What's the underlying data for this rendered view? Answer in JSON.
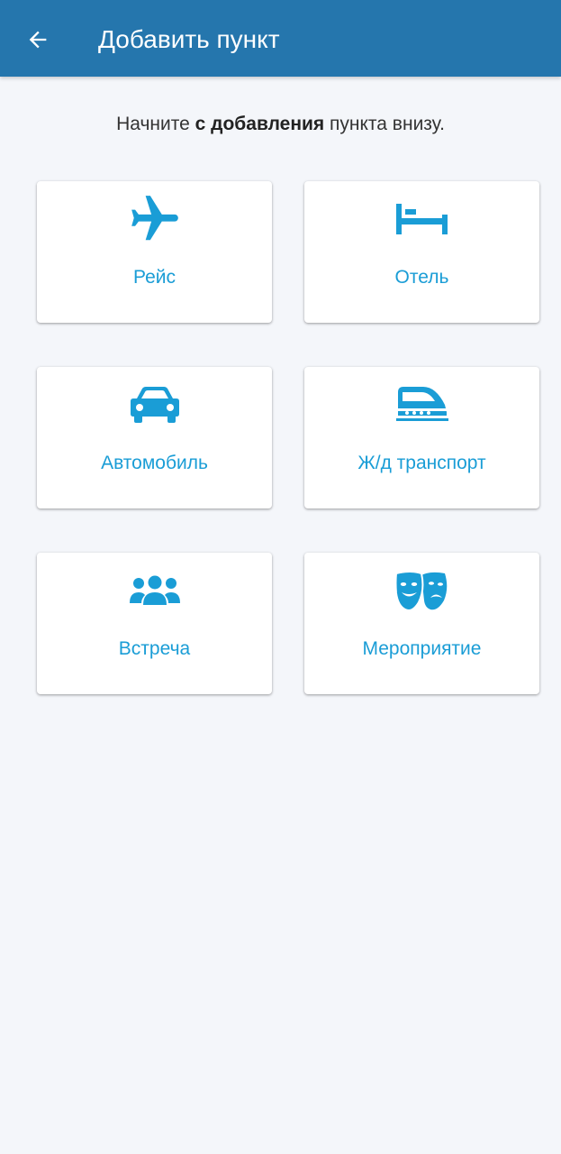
{
  "header": {
    "back_icon": "arrow-left-icon",
    "title": "Добавить пункт"
  },
  "intro": {
    "text_before": "Начните ",
    "text_bold": "с добавления",
    "text_after": " пункта внизу."
  },
  "options": [
    {
      "label": "Рейс",
      "icon": "airplane-icon"
    },
    {
      "label": "Отель",
      "icon": "bed-icon"
    },
    {
      "label": "Автомобиль",
      "icon": "car-icon"
    },
    {
      "label": "Ж/д транспорт",
      "icon": "train-icon"
    },
    {
      "label": "Встреча",
      "icon": "group-icon"
    },
    {
      "label": "Мероприятие",
      "icon": "theater-masks-icon"
    }
  ],
  "colors": {
    "app_bar": "#2576ad",
    "accent": "#1a9dd6",
    "background": "#f4f6fa"
  }
}
